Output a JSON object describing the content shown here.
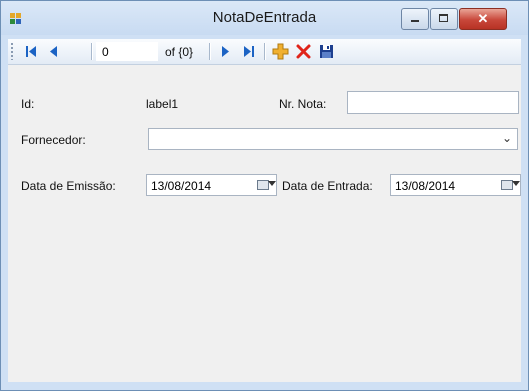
{
  "window": {
    "title": "NotaDeEntrada",
    "icon": "app-icon",
    "controls": [
      "minimize-icon",
      "maximize-icon",
      "close-icon"
    ]
  },
  "navigator": {
    "position": "0",
    "count_label": "of {0}",
    "buttons": [
      "move-first-icon",
      "move-previous-icon",
      "move-next-icon",
      "move-last-icon",
      "add-new-icon",
      "delete-icon",
      "save-icon"
    ]
  },
  "form": {
    "id_label": "Id:",
    "id_value": "label1",
    "nr_nota_label": "Nr. Nota:",
    "nr_nota_value": "",
    "fornecedor_label": "Fornecedor:",
    "fornecedor_value": "",
    "data_emissao_label": "Data de Emissão:",
    "data_emissao_value": "13/08/2014",
    "data_entrada_label": "Data de Entrada:",
    "data_entrada_value": "13/08/2014"
  },
  "colors": {
    "title_bar": "#c8dbf2",
    "close_button": "#c8473a",
    "navigator_icons": "#1c63c4",
    "add_icon": "#f0b030",
    "delete_icon": "#e0241a",
    "client_background": "#f0f0f0"
  }
}
